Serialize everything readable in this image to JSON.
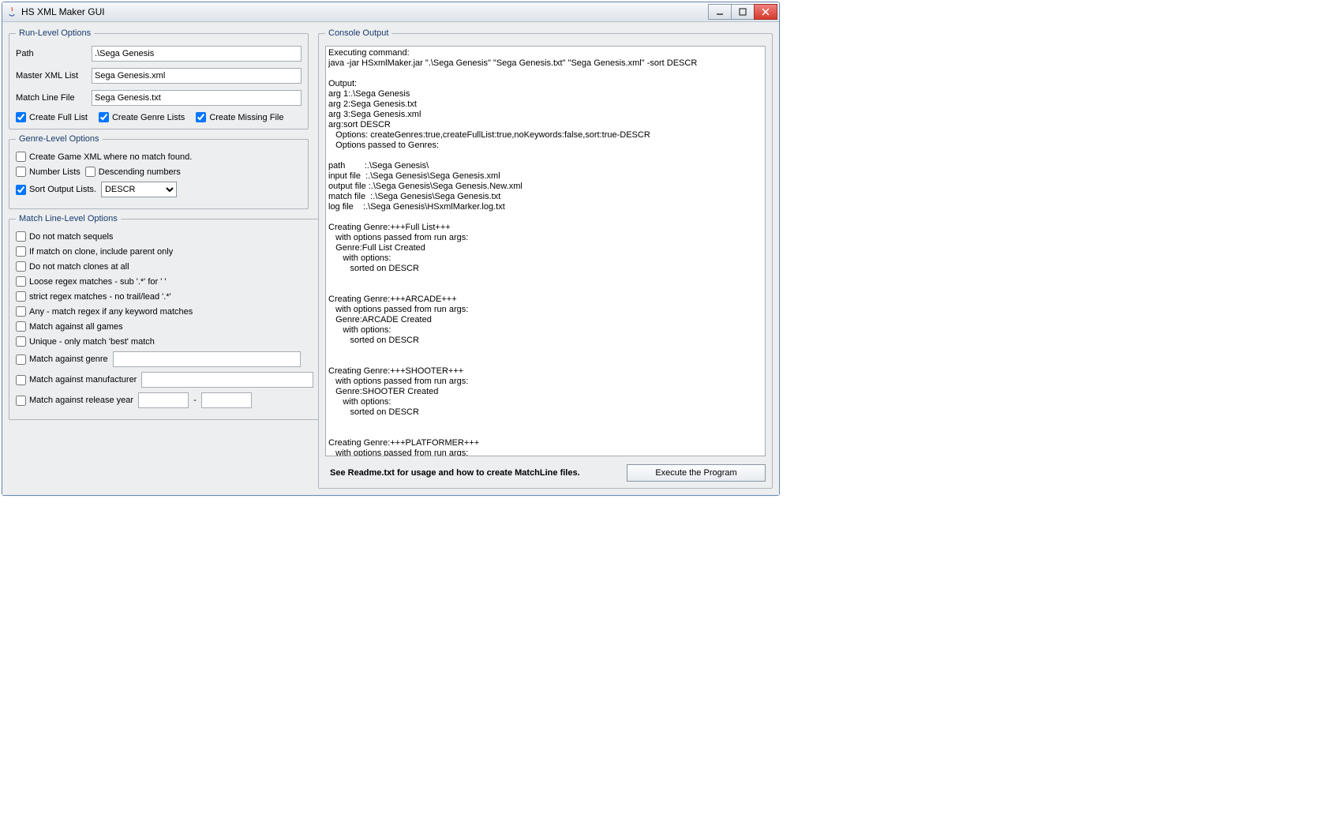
{
  "window": {
    "title": "HS XML Maker GUI"
  },
  "run_level": {
    "legend": "Run-Level Options",
    "path_label": "Path",
    "path_value": ".\\Sega Genesis",
    "master_label": "Master XML List",
    "master_value": "Sega Genesis.xml",
    "match_label": "Match Line File",
    "match_value": "Sega Genesis.txt",
    "create_full": "Create Full List",
    "create_genre": "Create Genre Lists",
    "create_missing": "Create Missing File"
  },
  "genre_level": {
    "legend": "Genre-Level Options",
    "create_game_xml": "Create Game XML where no match found.",
    "number_lists": "Number Lists",
    "desc_numbers": "Descending numbers",
    "sort_output": "Sort Output Lists.",
    "sort_value": "DESCR"
  },
  "match_level": {
    "legend": "Match Line-Level Options",
    "no_sequels": "Do not match sequels",
    "clone_parent": "If match on clone, include parent only",
    "no_clones": "Do not match clones at all",
    "loose_regex": "Loose regex matches - sub '.*' for ' '",
    "strict_regex": "strict regex matches - no trail/lead '.*'",
    "any_keyword": "Any - match regex if any keyword matches",
    "all_games": "Match against all games",
    "unique_best": "Unique - only match 'best' match",
    "against_genre": "Match against genre",
    "against_manu": "Match against manufacturer",
    "against_year": "Match against release year",
    "year_sep": "-"
  },
  "console": {
    "legend": "Console Output",
    "text": "Executing command:\njava -jar HSxmlMaker.jar \".\\Sega Genesis\" \"Sega Genesis.txt\" \"Sega Genesis.xml\" -sort DESCR\n\nOutput:\narg 1:.\\Sega Genesis\narg 2:Sega Genesis.txt\narg 3:Sega Genesis.xml\narg:sort DESCR\n   Options: createGenres:true,createFullList:true,noKeywords:false,sort:true-DESCR\n   Options passed to Genres:\n\npath        :.\\Sega Genesis\\\ninput file  :.\\Sega Genesis\\Sega Genesis.xml\noutput file :.\\Sega Genesis\\Sega Genesis.New.xml\nmatch file  :.\\Sega Genesis\\Sega Genesis.txt\nlog file    :.\\Sega Genesis\\HSxmlMarker.log.txt\n\nCreating Genre:+++Full List+++\n   with options passed from run args:\n   Genre:Full List Created\n      with options:\n         sorted on DESCR\n\n\nCreating Genre:+++ARCADE+++\n   with options passed from run args:\n   Genre:ARCADE Created\n      with options:\n         sorted on DESCR\n\n\nCreating Genre:+++SHOOTER+++\n   with options passed from run args:\n   Genre:SHOOTER Created\n      with options:\n         sorted on DESCR\n\n\nCreating Genre:+++PLATFORMER+++\n   with options passed from run args:"
  },
  "footer": {
    "readme": "See Readme.txt for usage and how to create MatchLine files.",
    "execute": "Execute the Program"
  }
}
